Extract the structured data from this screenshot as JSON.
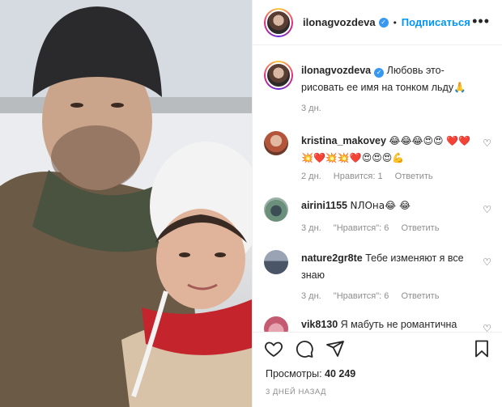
{
  "post": {
    "username": "ilonagvozdeva",
    "follow_label": "Подписаться",
    "dot": "•",
    "more_icon": "•••"
  },
  "caption": {
    "username": "ilonagvozdeva",
    "text": "Любовь это-рисовать ее имя на тонком льду🙏",
    "time": "3 дн."
  },
  "comments": [
    {
      "username": "kristina_makovey",
      "text": "😂😂😂😍😍 ❤️❤️💥❤️💥💥❤️😍😍😍💪",
      "time": "2 дн.",
      "likes": "Нравится: 1",
      "reply": "Ответить"
    },
    {
      "username": "airini1155",
      "text": "NЛОна😂 😂",
      "time": "3 дн.",
      "likes": "\"Нравится\": 6",
      "reply": "Ответить"
    },
    {
      "username": "nature2gr8te",
      "text": "Тебе изменяют я все знаю",
      "time": "3 дн.",
      "likes": "\"Нравится\": 6",
      "reply": "Ответить"
    },
    {
      "username": "vik8130",
      "text": "Я мабуть не романтична"
    }
  ],
  "footer": {
    "views_label": "Просмотры:",
    "views_count": "40 249",
    "ago": "3 ДНЕЙ НАЗАД"
  },
  "colors": {
    "link_blue": "#0095f6",
    "verified_blue": "#3897f0",
    "muted": "#8e8e8e"
  },
  "icons": [
    "like-heart-icon",
    "comment-icon",
    "share-icon",
    "bookmark-icon",
    "more-options-icon",
    "verified-icon",
    "small-heart-icon"
  ]
}
